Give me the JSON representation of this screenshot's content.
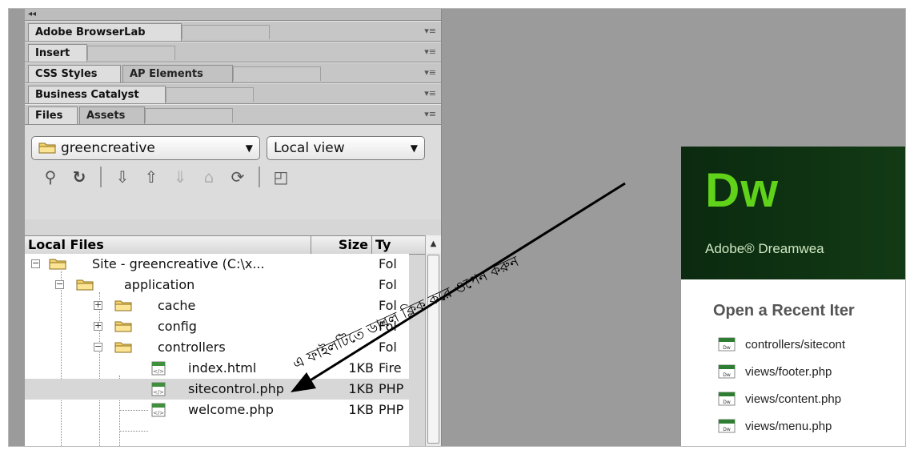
{
  "panel": {
    "collapse_glyph": "◂◂",
    "rows": [
      {
        "tabs": [
          "Adobe BrowserLab"
        ]
      },
      {
        "tabs": [
          "Insert"
        ]
      },
      {
        "tabs": [
          "CSS Styles",
          "AP Elements"
        ]
      },
      {
        "tabs": [
          "Business Catalyst"
        ]
      },
      {
        "tabs": [
          "Files",
          "Assets"
        ]
      }
    ],
    "menu_glyph": "▾≡"
  },
  "files": {
    "site_select": "greencreative",
    "view_select": "Local view",
    "toolbar_icons": [
      "connect-icon",
      "refresh-icon",
      "get-icon",
      "put-icon",
      "checkout-icon",
      "checkin-icon",
      "sync-icon",
      "expand-icon"
    ],
    "columns": {
      "name": "Local Files",
      "size": "Size",
      "type": "Ty"
    },
    "tree": [
      {
        "name": "Site - greencreative (C:\\x...",
        "size": "",
        "type": "Fol"
      },
      {
        "name": "application",
        "size": "",
        "type": "Fol"
      },
      {
        "name": "cache",
        "size": "",
        "type": "Fol"
      },
      {
        "name": "config",
        "size": "",
        "type": "Fol"
      },
      {
        "name": "controllers",
        "size": "",
        "type": "Fol"
      },
      {
        "name": "index.html",
        "size": "1KB",
        "type": "Fire"
      },
      {
        "name": "sitecontrol.php",
        "size": "1KB",
        "type": "PHP"
      },
      {
        "name": "welcome.php",
        "size": "1KB",
        "type": "PHP"
      }
    ]
  },
  "welcome": {
    "logo": "Dw",
    "subtitle": "Adobe® Dreamwea",
    "recent_title": "Open a Recent Iter",
    "recent_items": [
      "controllers/sitecont",
      "views/footer.php",
      "views/content.php",
      "views/menu.php"
    ]
  },
  "annotation": {
    "text": "এ ফাইলটিতে ডাবল ক্লিক করে ওপেন করুন"
  },
  "colors": {
    "dw_green": "#5fd219",
    "dw_bg": "#0b2a10",
    "workspace_gray": "#9b9b9b"
  }
}
